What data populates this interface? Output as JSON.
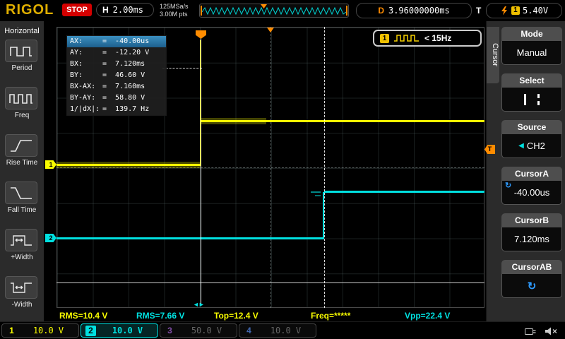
{
  "colors": {
    "ch1": "#f8fc00",
    "ch2": "#00e0e0",
    "ch3": "#a05fd0",
    "ch4": "#4f7fd9",
    "trigger_orange": "#ff8c00",
    "accent_blue": "#2e9bff",
    "stop_red": "#d40000",
    "brand_gold": "#dfae00",
    "cursor_highlight": "#2d7fae"
  },
  "icons": {
    "rotate_glyph": "↻",
    "source_arrow_glyph": "◀",
    "cursor_a_arrows_glyph": "◄►"
  },
  "top_bar": {
    "brand": "RIGOL",
    "run_state": "STOP",
    "h_label": "H",
    "timebase": "2.00ms",
    "sample_rate": "125MSa/s",
    "memory_depth": "3.00M pts",
    "d_label": "D",
    "delay": "3.96000000ms",
    "t_label": "T",
    "trigger_source": "1",
    "trigger_level": "5.40V"
  },
  "left_sidebar": {
    "title": "Horizontal",
    "items": [
      {
        "label": "Period",
        "icon": "period-icon"
      },
      {
        "label": "Freq",
        "icon": "freq-icon"
      },
      {
        "label": "Rise Time",
        "icon": "rise-time-icon"
      },
      {
        "label": "Fall Time",
        "icon": "fall-time-icon"
      },
      {
        "label": "+Width",
        "icon": "plus-width-icon"
      },
      {
        "label": "-Width",
        "icon": "minus-width-icon"
      }
    ]
  },
  "scope": {
    "cursor_readout": {
      "rows": [
        {
          "label": "AX:",
          "value": "=  -40.00us"
        },
        {
          "label": "AY:",
          "value": "=  -12.20 V"
        },
        {
          "label": "BX:",
          "value": "=  7.120ms"
        },
        {
          "label": "BY:",
          "value": "=  46.60 V"
        },
        {
          "label": "BX-AX:",
          "value": "=  7.160ms"
        },
        {
          "label": "BY-AY:",
          "value": "=  58.80 V"
        },
        {
          "label": "1/|dX|:",
          "value": "=  139.7 Hz"
        }
      ]
    },
    "trigger_freq_badge": {
      "channel": "1",
      "text": "< 15Hz"
    },
    "ch1_label": "1",
    "ch2_label": "2",
    "trigger_marker_label": "T",
    "measurements": [
      {
        "text": "RMS=10.4 V"
      },
      {
        "text": "RMS=7.66 V"
      },
      {
        "text": "Top=12.4 V"
      },
      {
        "text": "Freq=*****"
      },
      {
        "text": "Vpp=22.4 V"
      }
    ]
  },
  "right_menu": {
    "tab": "Cursor",
    "items": [
      {
        "label": "Mode",
        "value": "Manual"
      },
      {
        "label": "Select",
        "value": "",
        "icon": "cursor-lines-icon"
      },
      {
        "label": "Source",
        "value": "CH2"
      },
      {
        "label": "CursorA",
        "value": "-40.00us",
        "icon": "rotate-icon"
      },
      {
        "label": "CursorB",
        "value": "7.120ms"
      },
      {
        "label": "CursorAB",
        "value": "",
        "icon": "rotate-icon"
      }
    ]
  },
  "bottom_bar": {
    "channels": [
      {
        "num": "1",
        "scale": "10.0 V"
      },
      {
        "num": "2",
        "scale": "10.0 V"
      },
      {
        "num": "3",
        "scale": "50.0 V"
      },
      {
        "num": "4",
        "scale": "10.0 V"
      }
    ]
  }
}
